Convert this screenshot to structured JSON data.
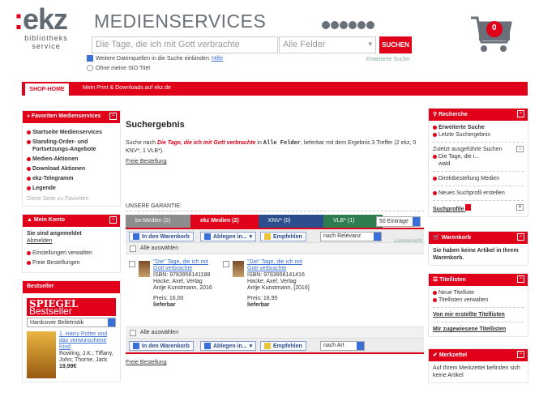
{
  "brand": {
    "logo_main": "ekz",
    "logo_dots": ":",
    "logo_sub1": "bibliotheks",
    "logo_sub2": "service"
  },
  "header": {
    "title": "MEDIENSERVICES",
    "search_value": "Die Tage, die ich mit Gott verbrachte",
    "field_select": "Alle Felder",
    "search_button": "SUCHEN",
    "option1": "Weitere Datenquellen in die Suche einbinden",
    "option1_help": "Hilfe",
    "option2": "Ohne meine SIO Titel",
    "advanced": "Erweiterte Suche",
    "cart_count": "0"
  },
  "nav": {
    "tab": "SHOP-HOME",
    "text": "Mein Print & Downloads auf ekz.de"
  },
  "favorites": {
    "title": "Favoriten Medienservices",
    "items": [
      "Startseite Medienservices",
      "Standing-Order- und Fortsetzungs-Angebote",
      "Medien-Aktionen",
      "Download Aktionen",
      "ekz-Telegramm",
      "Legende"
    ],
    "hint": "Diese Seite zu Favoriten"
  },
  "account": {
    "title": "Mein Konto",
    "status": "Sie sind angemeldet",
    "logout": "Abmelden",
    "links": [
      "Einstellungen verwalten",
      "Freie Bestellungen"
    ]
  },
  "bestseller": {
    "title": "Bestseller",
    "brand": "SPIEGEL",
    "brand2": "Bestseller",
    "select": "Hardcover Belletristik",
    "book_title": "1. Harry Potter und das verwunschene Kind",
    "book_authors": "Rowling, J.K.; Tiffany, John; Thorne, Jack",
    "book_price": "19,99€"
  },
  "main": {
    "heading": "Suchergebnis",
    "intro_pre": "Suche nach",
    "intro_query": "Die Tage, die ich mit Gott verbrachte",
    "intro_in": "in",
    "intro_field": "Alle Felder",
    "intro_post": ", lieferbar mit dem Ergebnis 3 Treffer (2 ekz, 0 KNV*, 1 VLB*).",
    "freie": "Freie Bestellung",
    "guarantee": "UNSERE GARANTIE:",
    "tabs": [
      "bv-Medien (2)",
      "ekz Medien (2)",
      "KNV* (0)",
      "VLB* (1)"
    ],
    "per_page": "50 Einträge",
    "btn_cart": "In den Warenkorb",
    "btn_store": "Ablegen in...",
    "btn_rec": "Empfehlen",
    "sort1": "nach Relevanz",
    "sort2": "nach Art",
    "list_view": "Listenansicht",
    "select_all": "Alle auswählen",
    "results": [
      {
        "title": "\"Die\" Tage, die ich mit Gott verbrachte",
        "isbn": "ISBN: 9783956141188",
        "publisher": "Hacke, Axel, Verlag Antje Kunstmann, 2016",
        "price": "Preis: 16,00",
        "avail": "lieferbar"
      },
      {
        "title": "\"Die\" Tage, die ich mit Gott verbrachte",
        "isbn": "ISBN: 9783956141416",
        "publisher": "Hacke, Axel, Verlag Antje Kunstmann, [2016]",
        "price": "Preis: 16,95",
        "avail": "lieferbar"
      }
    ],
    "freie2": "Freie Bestellung"
  },
  "recherche": {
    "title": "Recherche",
    "items": [
      "Erweiterte Suche",
      "Letzte Suchergebnis"
    ],
    "last_label": "Zuletzt ausgeführte Suchen",
    "last_item": "Die Tage, die i...",
    "last_sub": "wald",
    "direct": "Direktbestellung Medien",
    "profile": "Neues Suchprofil erstellen",
    "profiles": "Suchprofile"
  },
  "cart": {
    "title": "Warenkorb",
    "text": "Sie haben keine Artikel in Ihrem Warenkorb."
  },
  "lists": {
    "title": "Titellisten",
    "items": [
      "Neue Titelliste",
      "Titellisten verwalten"
    ],
    "link1": "Von mir erstellte Titellisten",
    "link2": "Mir zugewiesene Titellisten"
  },
  "memo": {
    "title": "Merkzettel",
    "text": "Auf Ihrem Merkzettel befinden sich keine Artikel"
  },
  "colors": {
    "accent": "#e0001a",
    "blue": "#2d4e8c",
    "green": "#2e7d4f",
    "grey": "#8d8d8d"
  }
}
